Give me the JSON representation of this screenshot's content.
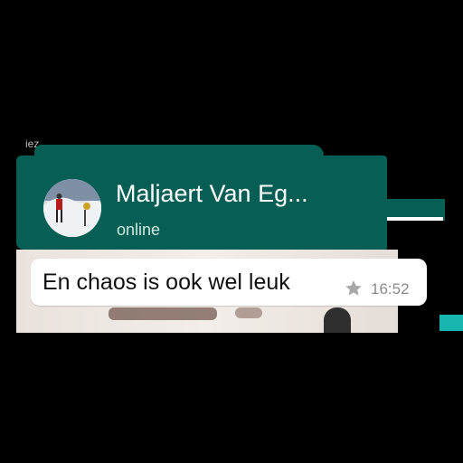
{
  "status_bar": {
    "fragment": "iez"
  },
  "header": {
    "contact_name": "Maljaert Van Eg...",
    "contact_status": "online",
    "colors": {
      "bar": "#075e54"
    }
  },
  "avatar": {
    "icon": "avatar-photo"
  },
  "message": {
    "text": "En chaos is ook wel leuk",
    "time": "16:52",
    "starred": true,
    "icon": "star-icon"
  }
}
